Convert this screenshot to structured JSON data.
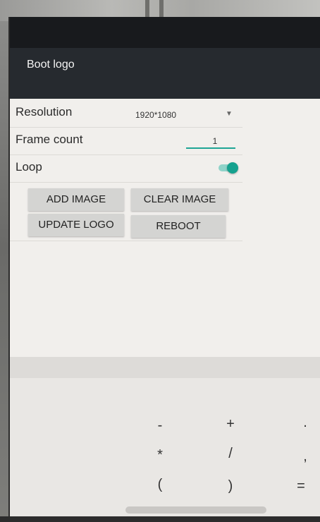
{
  "app": {
    "title": "Boot logo"
  },
  "settings": {
    "resolution": {
      "label": "Resolution",
      "value": "1920*1080"
    },
    "frame_count": {
      "label": "Frame count",
      "value": "1"
    },
    "loop": {
      "label": "Loop",
      "enabled": true
    }
  },
  "buttons": {
    "add_image": "ADD IMAGE",
    "clear_image": "CLEAR IMAGE",
    "update_logo": "UPDATE LOGO",
    "reboot": "REBOOT"
  },
  "keyboard": {
    "rows": [
      [
        "-",
        "+",
        "."
      ],
      [
        "*",
        "/",
        ","
      ],
      [
        "(",
        ")",
        "="
      ]
    ]
  },
  "colors": {
    "accent": "#15a18e",
    "app_bar": "#262a2f",
    "status_bar": "#181a1d",
    "background": "#f1efec"
  }
}
